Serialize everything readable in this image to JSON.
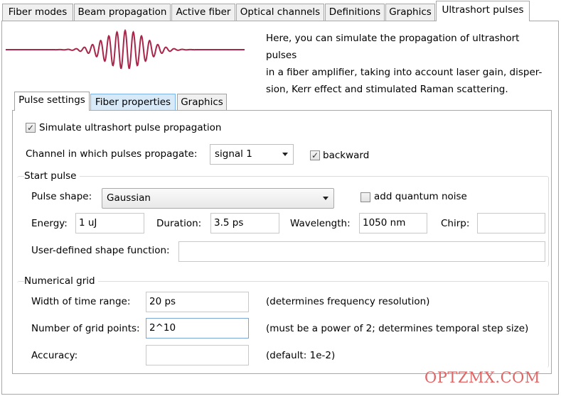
{
  "main_tabs": [
    "Fiber modes",
    "Beam propagation",
    "Active fiber",
    "Optical channels",
    "Definitions",
    "Graphics",
    "Ultrashort pulses"
  ],
  "description": "Here, you can simulate the propagation of ultrashort pulses in a fiber amplifier, taking into account laser gain, dispersion, Kerr effect and stimulated Raman scattering.",
  "description_lines": [
    "Here, you can simulate the propagation of ultrashort pulses",
    "in a fiber amplifier, taking into account laser gain, disper-",
    "sion, Kerr effect and stimulated Raman scattering."
  ],
  "inner_tabs": [
    "Pulse settings",
    "Fiber properties",
    "Graphics"
  ],
  "simulate": {
    "label": "Simulate ultrashort pulse propagation",
    "checked": true
  },
  "channel": {
    "label": "Channel in which pulses propagate:",
    "value": "signal 1"
  },
  "backward": {
    "label": "backward",
    "checked": true
  },
  "start_pulse": {
    "title": "Start pulse",
    "shape_label": "Pulse shape:",
    "shape_value": "Gaussian",
    "noise_label": "add quantum noise",
    "noise_checked": false,
    "energy_label": "Energy:",
    "energy_value": "1 uJ",
    "duration_label": "Duration:",
    "duration_value": "3.5 ps",
    "wavelength_label": "Wavelength:",
    "wavelength_value": "1050 nm",
    "chirp_label": "Chirp:",
    "chirp_value": "",
    "userdef_label": "User-defined shape function:",
    "userdef_value": ""
  },
  "grid": {
    "title": "Numerical grid",
    "width_label": "Width of time range:",
    "width_value": "20 ps",
    "width_note": "(determines frequency resolution)",
    "points_label": "Number of grid points:",
    "points_value": "2^10",
    "points_note": "(must be a power of 2; determines temporal step size)",
    "accuracy_label": "Accuracy:",
    "accuracy_value": "",
    "accuracy_note": "(default: 1e-2)"
  },
  "watermark": "OPTZMX.COM",
  "colors": {
    "pulse": "#a8264a",
    "active_inner_tab": "#d8eaf7",
    "watermark": "#e06565"
  },
  "icons": {
    "checkmark": "check-icon",
    "dropdown": "chevron-down-icon"
  }
}
